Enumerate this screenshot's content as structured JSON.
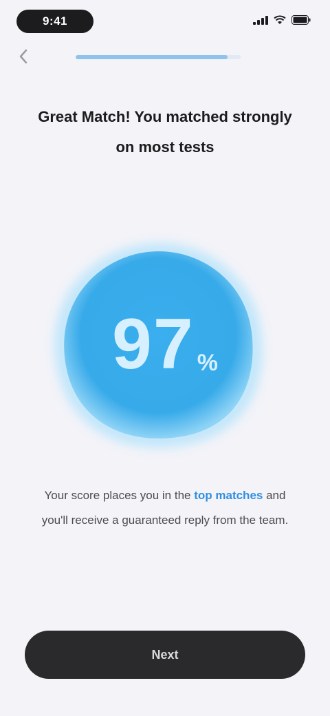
{
  "status_bar": {
    "time": "9:41"
  },
  "nav": {
    "back_icon": "chevron-left-icon",
    "progress_fraction": 0.92
  },
  "headline": {
    "text": "Great Match! You matched strongly on most tests"
  },
  "score": {
    "value": "97",
    "unit": "%"
  },
  "description": {
    "prefix": "Your score places you in the",
    "highlight": "top matches",
    "suffix": "and you'll receive a guaranteed reply from the team."
  },
  "cta": {
    "label": "Next"
  },
  "colors": {
    "background": "#f3f3f8",
    "score_blue": "#3bb0ee",
    "accent": "#2f8fe0",
    "button": "#2a2a2c"
  }
}
